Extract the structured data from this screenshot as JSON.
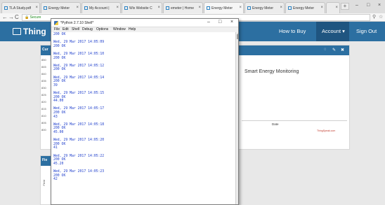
{
  "browser": {
    "tabs": [
      {
        "label": "TLA Study.pdf"
      },
      {
        "label": "Energy Meter"
      },
      {
        "label": "My Account |"
      },
      {
        "label": "Wix Website C"
      },
      {
        "label": "emeter | Home"
      },
      {
        "label": "Energy Meter"
      },
      {
        "label": "Energy Meter"
      },
      {
        "label": "Energy Meter"
      },
      {
        "label": ""
      }
    ],
    "url": "Secure"
  },
  "thingspeak": {
    "logo": "Thing",
    "nav": {
      "how_to_buy": "How to Buy",
      "account": "Account ▾",
      "sign_out": "Sign Out"
    },
    "left_card_title": "Cur",
    "left_card2_title": "Fie",
    "y_ticks": [
      "850",
      "845",
      "840",
      "835",
      "830",
      "825",
      "820",
      "815",
      "810",
      "805",
      "800"
    ],
    "chart_title": "Smart Energy Monitoring",
    "chart_xlabel": "Date",
    "chart_credit": "ThingSpeak.com",
    "left_axis_label": "Field"
  },
  "idle": {
    "title": "*Python 2.7.10 Shell*",
    "menu": [
      "File",
      "Edit",
      "Shell",
      "Debug",
      "Options",
      "Window",
      "Help"
    ],
    "lines": [
      "200 OK",
      "",
      "Wed, 29 Mar 2017 14:05:09",
      "200 OK",
      "",
      "Wed, 29 Mar 2017 14:05:10",
      "200 OK",
      "",
      "Wed, 29 Mar 2017 14:05:12",
      "200 OK",
      "",
      "Wed, 29 Mar 2017 14:05:14",
      "200 OK",
      "39",
      "",
      "Wed, 29 Mar 2017 14:05:15",
      "200 OK",
      "44.00",
      "",
      "Wed, 29 Mar 2017 14:05:17",
      "200 OK",
      "43",
      "",
      "Wed, 29 Mar 2017 14:05:18",
      "200 OK",
      "45.00",
      "",
      "Wed, 29 Mar 2017 14:05:20",
      "200 OK",
      "41",
      "",
      "Wed, 29 Mar 2017 14:05:22",
      "200 OK",
      "45.20",
      "",
      "Wed, 29 Mar 2017 14:05:23",
      "200 OK",
      "42"
    ]
  }
}
